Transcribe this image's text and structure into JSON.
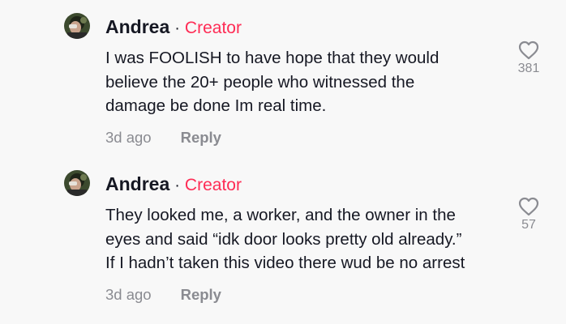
{
  "comments": [
    {
      "author": "Andrea",
      "separator": "·",
      "badge": "Creator",
      "text_lines": [
        "I was FOOLISH to have hope that they would",
        "believe the 20+ people who witnessed the",
        "damage be done Im real time."
      ],
      "time": "3d ago",
      "reply_label": "Reply",
      "likes": "381",
      "icon": "heart-outline-icon"
    },
    {
      "author": "Andrea",
      "separator": "·",
      "badge": "Creator",
      "text_lines": [
        "They looked me, a worker, and the owner in the",
        "eyes and said “idk door looks pretty old already.”",
        "If I hadn’t taken this video there wud be no arrest"
      ],
      "time": "3d ago",
      "reply_label": "Reply",
      "likes": "57",
      "icon": "heart-outline-icon"
    }
  ],
  "colors": {
    "background": "#f8f8f8",
    "text": "#161823",
    "muted": "#8a8b91",
    "badge": "#fe2c55"
  }
}
